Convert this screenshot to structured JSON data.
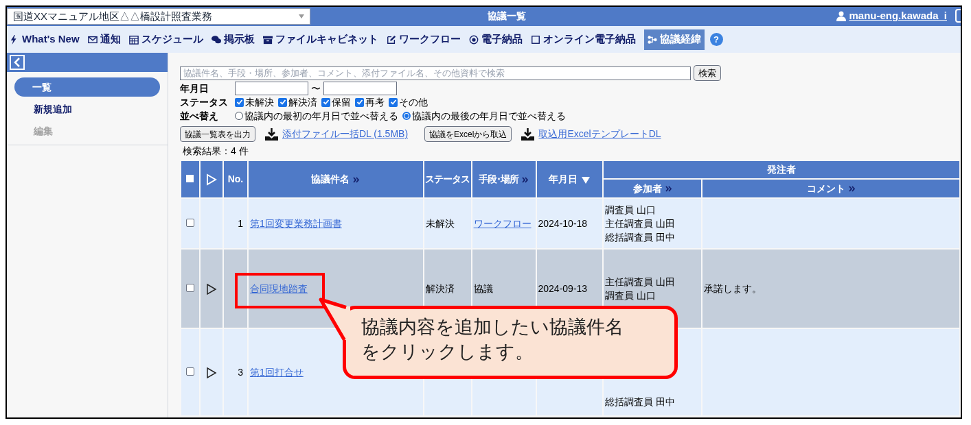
{
  "top_bar": {
    "project_select": "国道XXマニュアル地区△△橋設計照査業務",
    "title": "協議一覧",
    "user": "manu-eng.kawada_i"
  },
  "nav": {
    "items": [
      {
        "label": "What's New",
        "selected": false
      },
      {
        "label": "通知",
        "selected": false
      },
      {
        "label": "スケジュール",
        "selected": false
      },
      {
        "label": "掲示板",
        "selected": false
      },
      {
        "label": "ファイルキャビネット",
        "selected": false
      },
      {
        "label": "ワークフロー",
        "selected": false
      },
      {
        "label": "電子納品",
        "selected": false
      },
      {
        "label": "オンライン電子納品",
        "selected": false
      },
      {
        "label": "協議経緯",
        "selected": true
      }
    ],
    "help": "?"
  },
  "sidebar": {
    "items": [
      {
        "label": "一覧",
        "selected": true,
        "disabled": false
      },
      {
        "label": "新規追加",
        "selected": false,
        "disabled": false
      },
      {
        "label": "編集",
        "selected": false,
        "disabled": true
      }
    ]
  },
  "search": {
    "placeholder": "協議件名、手段・場所、参加者、コメント、添付ファイル名、その他資料で検索",
    "button": "検索"
  },
  "filters": {
    "date_label": "年月日",
    "date_separator": "〜",
    "status_label": "ステータス",
    "statuses": [
      {
        "label": "未解決",
        "checked": true
      },
      {
        "label": "解決済",
        "checked": true
      },
      {
        "label": "保留",
        "checked": true
      },
      {
        "label": "再考",
        "checked": true
      },
      {
        "label": "その他",
        "checked": true
      }
    ],
    "sort_label": "並べ替え",
    "sort_options": [
      {
        "label": "協議内の最初の年月日で並べ替える",
        "selected": false
      },
      {
        "label": "協議内の最後の年月日で並べ替える",
        "selected": true
      }
    ]
  },
  "actions": [
    {
      "kind": "button",
      "label": "協議一覧表を出力"
    },
    {
      "kind": "download",
      "label": "添付ファイル一括DL (1.5MB)"
    },
    {
      "kind": "button",
      "label": "協議をExcelから取込"
    },
    {
      "kind": "download",
      "label": "取込用ExcelテンプレートDL"
    }
  ],
  "result_count": "検索結果：4 件",
  "table": {
    "select_all_checked": false,
    "columns": {
      "no": "No.",
      "name": "協議件名",
      "status": "ステータス",
      "means": "手段･場所",
      "date": "年月日",
      "group": "発注者",
      "participants": "参加者",
      "comment": "コメント"
    },
    "rows": [
      {
        "checked": false,
        "expandable": false,
        "highlighted": false,
        "no": "1",
        "name": "第1回変更業務計画書",
        "status": "未解決",
        "means": "ワークフロー",
        "means_link": true,
        "date": "2024-10-18",
        "participants": [
          "調査員 山口",
          "主任調査員 山田",
          "総括調査員 田中"
        ]
      },
      {
        "checked": false,
        "expandable": true,
        "highlighted": true,
        "name": "合同現地踏査",
        "status": "解決済",
        "means": "協議",
        "means_link": false,
        "date": "2024-09-13",
        "participants": [
          "主任調査員 山田",
          "調査員 山口"
        ],
        "comment": "承諾します。"
      },
      {
        "checked": false,
        "expandable": true,
        "highlighted": false,
        "no": "3",
        "name": "第1回打合せ",
        "participants": [
          "総括調査員 田中"
        ]
      }
    ]
  },
  "callout": {
    "lines": [
      "協議内容を追加したい協議件名",
      "をクリックします。"
    ]
  }
}
